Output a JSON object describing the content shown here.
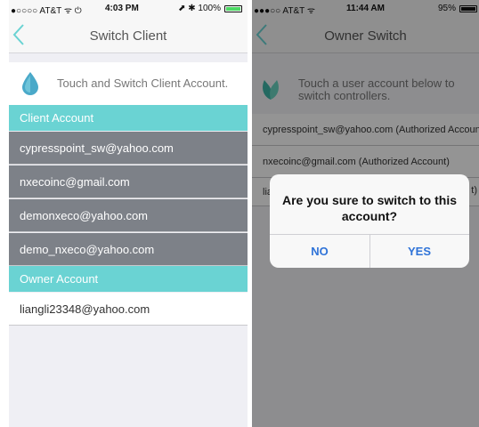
{
  "colors": {
    "teal": "#6ad3d3",
    "accent_blue": "#2f73d8",
    "battery_green": "#4cd964"
  },
  "left": {
    "status": {
      "carrier": "●○○○○ AT&T ᯤ ⏻",
      "time": "4:03 PM",
      "battery": "⬈ ✱ 100%"
    },
    "nav": {
      "back_icon": "chevron-left",
      "title": "Switch Client"
    },
    "header": {
      "icon": "water-drop",
      "text": "Touch and Switch Client Account."
    },
    "client_section": "Client Account",
    "clients": [
      "cypresspoint_sw@yahoo.com",
      "nxecoinc@gmail.com",
      "demonxeco@yahoo.com",
      "demo_nxeco@yahoo.com"
    ],
    "owner_section": "Owner Account",
    "owners": [
      "liangli23348@yahoo.com"
    ]
  },
  "right": {
    "status": {
      "carrier": "●●●○○ AT&T ᯤ",
      "time": "11:44 AM",
      "battery": "95%"
    },
    "nav": {
      "back_icon": "chevron-left",
      "title": "Owner Switch"
    },
    "header": {
      "icon": "leaf",
      "line1": "Touch a user account below to",
      "line2": "switch controllers."
    },
    "rows": [
      "cypresspoint_sw@yahoo.com (Authorized Account)",
      "nxecoinc@gmail.com (Authorized Account)",
      "lia",
      "t)"
    ],
    "dialog": {
      "message_line1": "Are you sure to switch to this",
      "message_line2": "account?",
      "no": "NO",
      "yes": "YES"
    }
  }
}
